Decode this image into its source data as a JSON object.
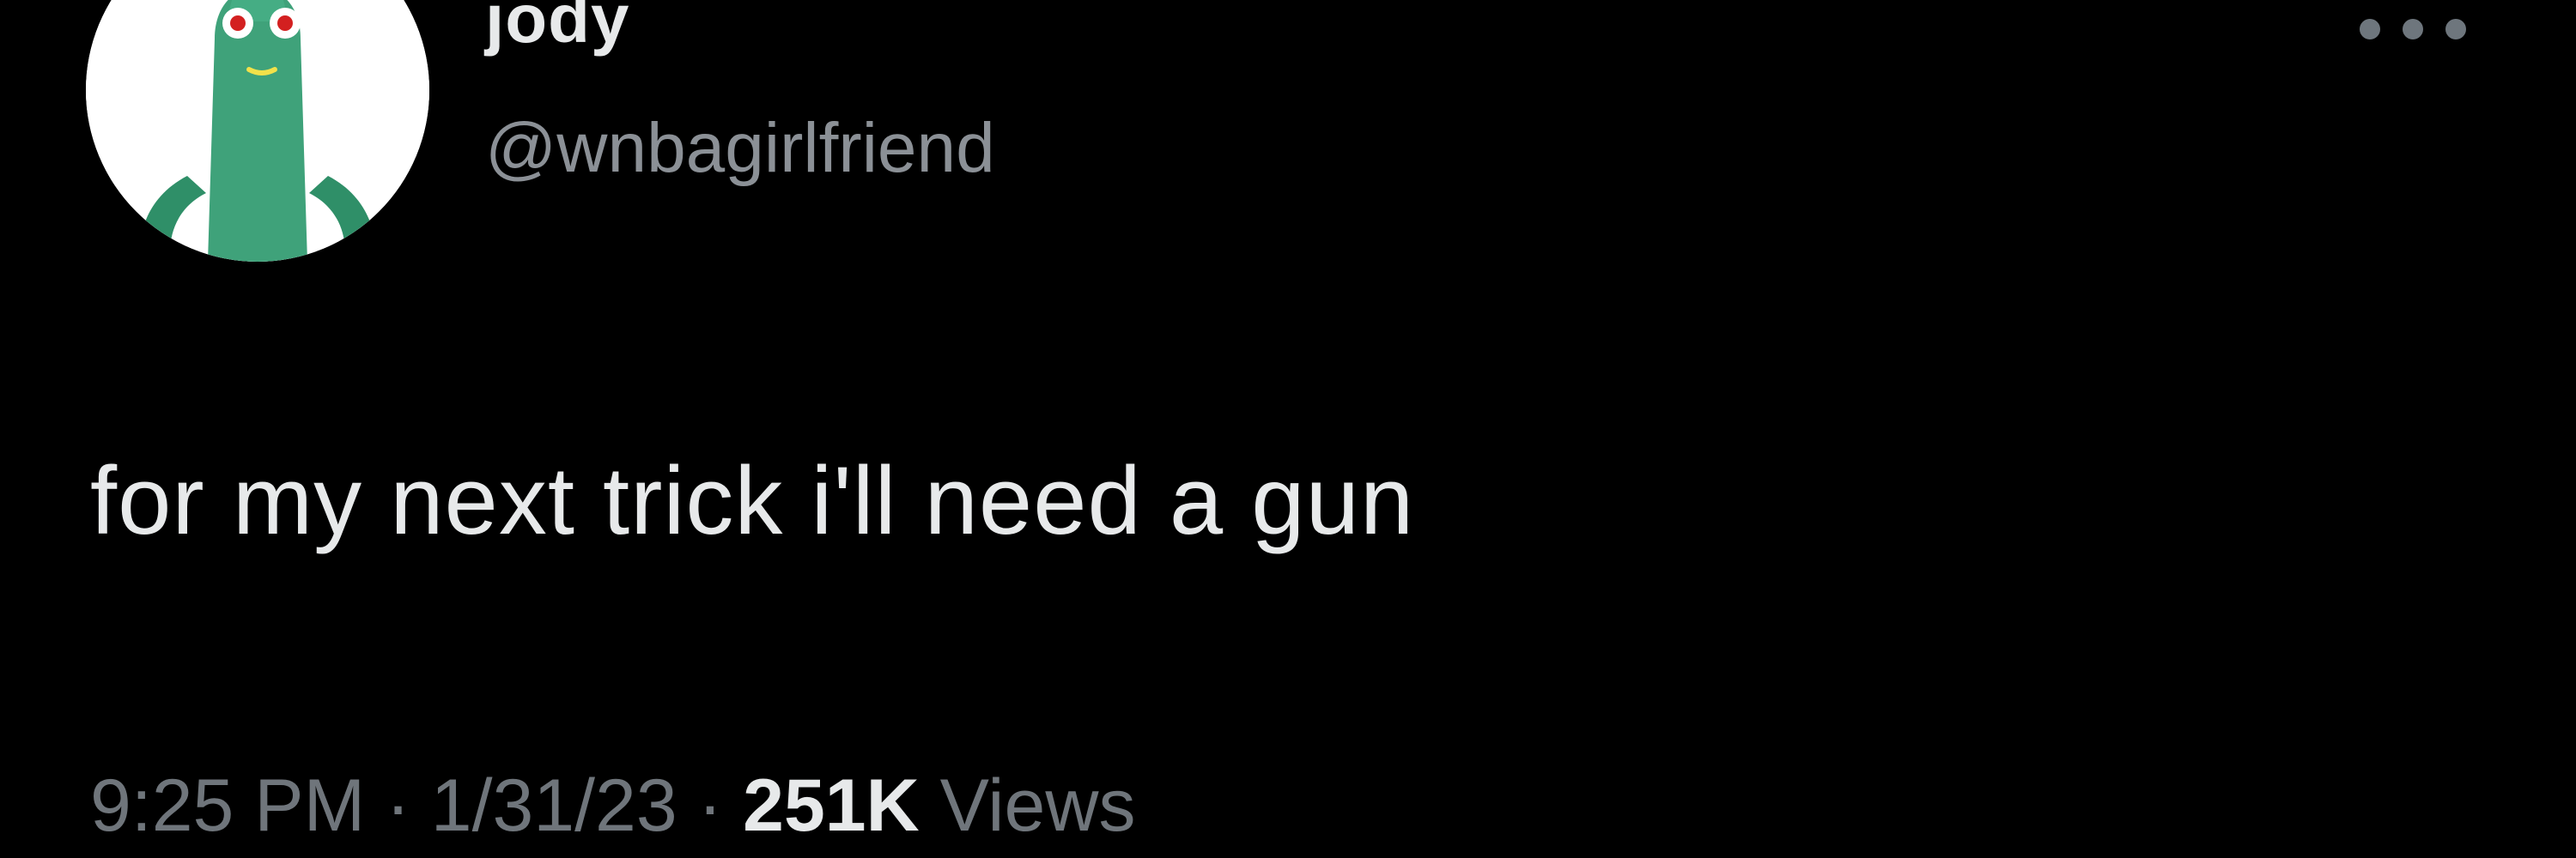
{
  "tweet": {
    "author": {
      "display_name": "jody",
      "handle": "@wnbagirlfriend",
      "avatar_icon": "cartoon-avatar-icon"
    },
    "text": "for my next trick i'll need a gun",
    "meta": {
      "time": "9:25 PM",
      "separator": "·",
      "date": "1/31/23",
      "views_count": "251K",
      "views_label": "Views"
    },
    "more_icon": "more-options-icon"
  },
  "colors": {
    "background": "#000000",
    "primary_text": "#e7e9ea",
    "secondary_text": "#6f757b",
    "avatar_background": "#ffffff",
    "avatar_figure": "#3fa27a"
  }
}
